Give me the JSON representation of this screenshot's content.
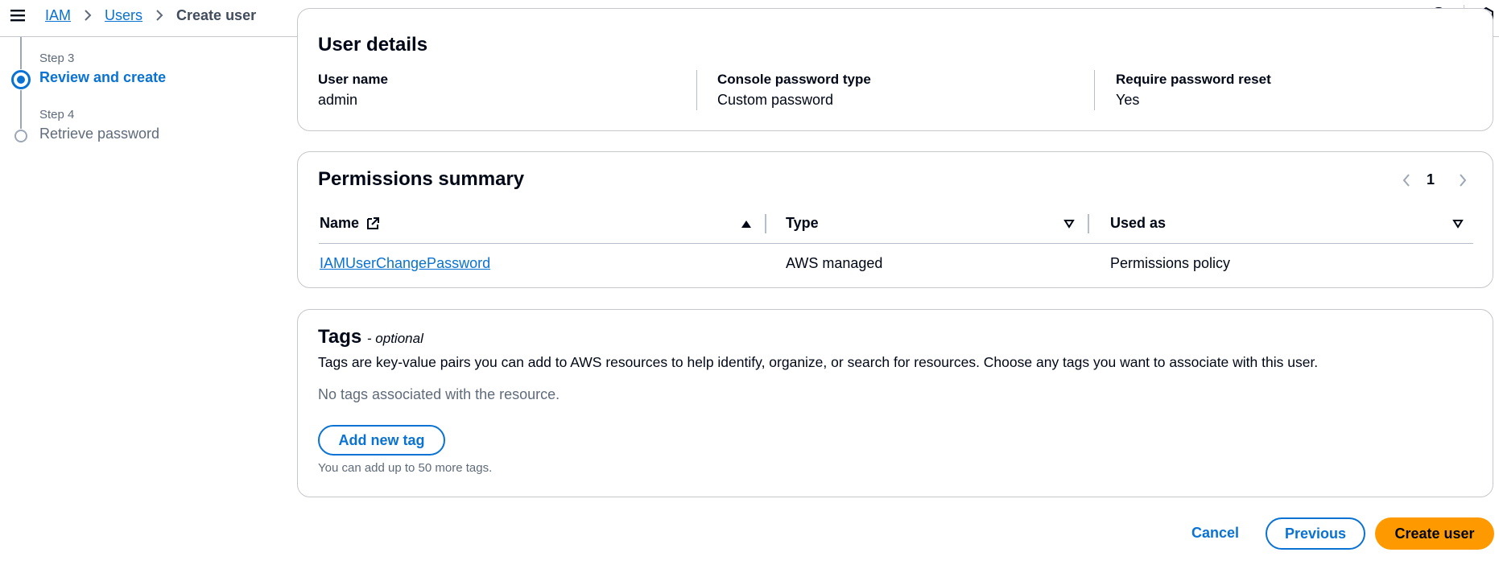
{
  "breadcrumb": {
    "items": [
      {
        "label": "IAM"
      },
      {
        "label": "Users"
      }
    ],
    "current": "Create user"
  },
  "stepper": {
    "steps": [
      {
        "step_label": "Step 3",
        "title": "Review and create",
        "state": "active"
      },
      {
        "step_label": "Step 4",
        "title": "Retrieve password",
        "state": "inactive"
      }
    ]
  },
  "user_details": {
    "heading": "User details",
    "fields": [
      {
        "label": "User name",
        "value": "admin"
      },
      {
        "label": "Console password type",
        "value": "Custom password"
      },
      {
        "label": "Require password reset",
        "value": "Yes"
      }
    ]
  },
  "permissions": {
    "heading": "Permissions summary",
    "page": "1",
    "columns": [
      {
        "label": "Name",
        "sort": "ascending"
      },
      {
        "label": "Type",
        "sort": "none"
      },
      {
        "label": "Used as",
        "sort": "none"
      }
    ],
    "rows": [
      {
        "name": "IAMUserChangePassword",
        "type": "AWS managed",
        "used_as": "Permissions policy"
      }
    ]
  },
  "tags": {
    "heading": "Tags",
    "optional": "- optional",
    "description": "Tags are key-value pairs you can add to AWS resources to help identify, organize, or search for resources. Choose any tags you want to associate with this user.",
    "empty_text": "No tags associated with the resource.",
    "add_button": "Add new tag",
    "hint": "You can add up to 50 more tags."
  },
  "footer": {
    "cancel": "Cancel",
    "previous": "Previous",
    "create": "Create user"
  },
  "colors": {
    "link": "#0972d3",
    "primary_button": "#ff9900",
    "text": "#000716",
    "secondary_text": "#5f6b7a"
  }
}
